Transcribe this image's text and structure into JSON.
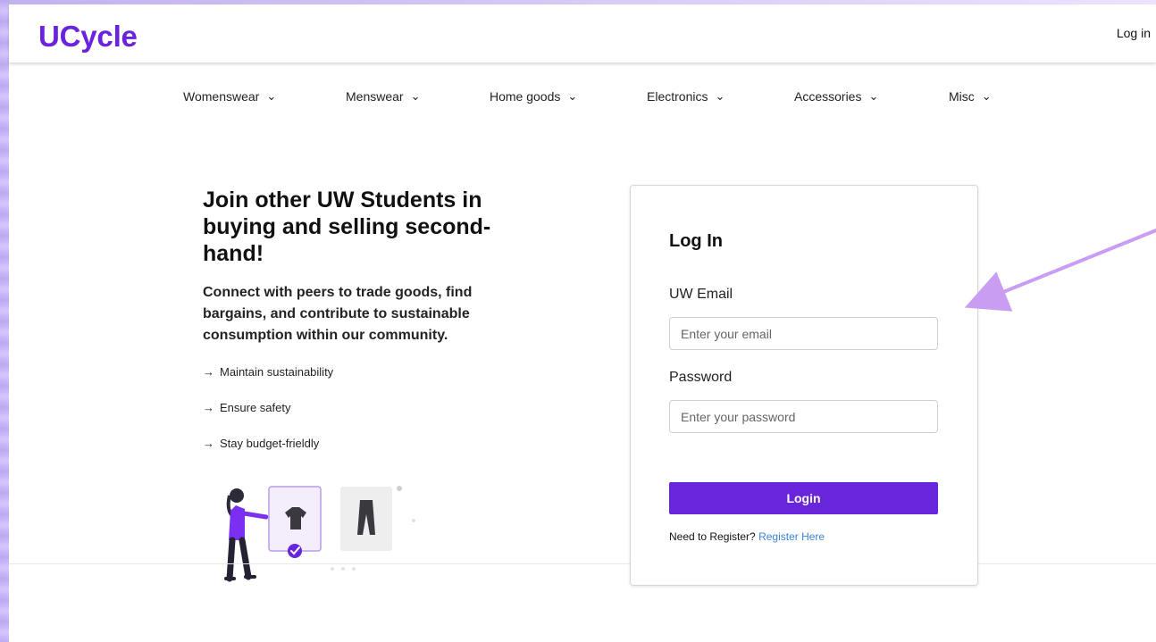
{
  "brand": {
    "name": "UCycle",
    "color": "#6a22df"
  },
  "header": {
    "login_link": "Log in"
  },
  "navigation": {
    "items": [
      {
        "label": "Womenswear",
        "icon": "chevron-down-icon"
      },
      {
        "label": "Menswear",
        "icon": "chevron-down-icon"
      },
      {
        "label": "Home goods",
        "icon": "chevron-down-icon"
      },
      {
        "label": "Electronics",
        "icon": "chevron-down-icon"
      },
      {
        "label": "Accessories",
        "icon": "chevron-down-icon"
      },
      {
        "label": "Misc",
        "icon": "chevron-down-icon"
      }
    ]
  },
  "hero": {
    "title": "Join other UW Students in buying and selling second-hand!",
    "subtitle": "Connect with peers to trade goods, find bargains, and contribute to sustainable consumption within our community.",
    "benefits": [
      {
        "arrow": "→",
        "label": "Maintain sustainability"
      },
      {
        "arrow": "→",
        "label": "Ensure safety"
      },
      {
        "arrow": "→",
        "label": "Stay budget-frieldly"
      }
    ],
    "illustration_icons": [
      "person-illustration-icon",
      "shirt-icon",
      "pants-icon",
      "checkmark-icon"
    ]
  },
  "login_card": {
    "title": "Log In",
    "email_label": "UW Email",
    "email_value": "",
    "email_placeholder": "Enter your email",
    "password_label": "Password",
    "password_value": "",
    "password_placeholder": "Enter your password",
    "button_label": "Login",
    "register_prompt": "Need to Register?",
    "register_link": "Register Here",
    "button_color": "#6925db",
    "link_color": "#3a84d8"
  },
  "annotation": {
    "icon": "arrow-pointer-icon",
    "color": "#c99ef2"
  }
}
